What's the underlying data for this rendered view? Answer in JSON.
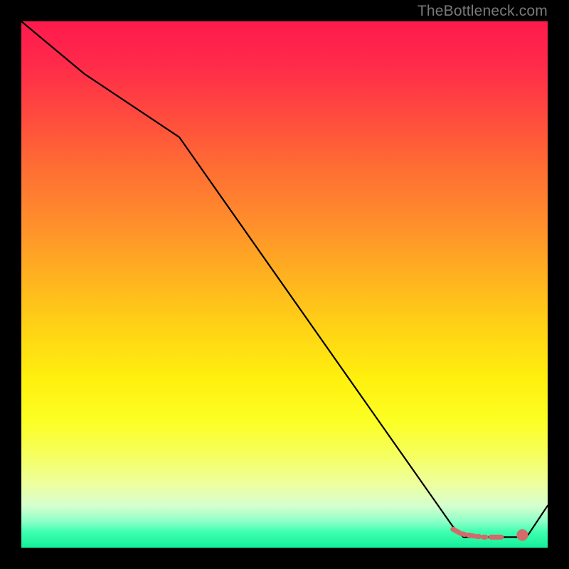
{
  "watermark": "TheBottleneck.com",
  "chart_data": {
    "type": "line",
    "title": "",
    "xlabel": "",
    "ylabel": "",
    "xlim": [
      0,
      100
    ],
    "ylim": [
      0,
      100
    ],
    "grid": false,
    "series": [
      {
        "name": "curve",
        "x": [
          0,
          12,
          30,
          82,
          84,
          96,
          100
        ],
        "y": [
          100,
          90,
          78,
          4,
          2,
          2,
          8
        ]
      }
    ],
    "markers": {
      "name": "dashed-band",
      "color": "#d46a6a",
      "segments": [
        {
          "x0": 82.0,
          "y0": 3.5,
          "x1": 83.3,
          "y1": 2.8
        },
        {
          "x0": 83.9,
          "y0": 2.6,
          "x1": 84.2,
          "y1": 2.5
        },
        {
          "x0": 84.9,
          "y0": 2.4,
          "x1": 86.0,
          "y1": 2.2
        },
        {
          "x0": 86.6,
          "y0": 2.1,
          "x1": 87.0,
          "y1": 2.1
        },
        {
          "x0": 87.8,
          "y0": 2.0,
          "x1": 88.2,
          "y1": 2.0
        },
        {
          "x0": 89.2,
          "y0": 2.0,
          "x1": 91.2,
          "y1": 2.0
        },
        {
          "x0": 94.8,
          "y0": 2.3,
          "x1": 95.6,
          "y1": 2.5
        }
      ],
      "dot": {
        "x": 95.2,
        "y": 2.4,
        "r": 1.1
      }
    }
  }
}
